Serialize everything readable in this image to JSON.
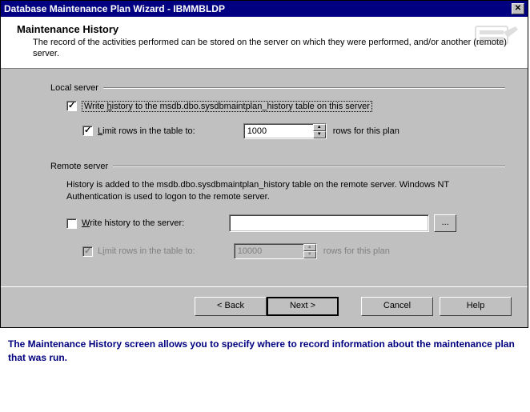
{
  "window": {
    "title": "Database Maintenance Plan Wizard - IBMMBLDP"
  },
  "header": {
    "title": "Maintenance History",
    "description": "The record of the activities performed can be stored on the server on which they were performed, and/or another (remote) server."
  },
  "local": {
    "group_label": "Local server",
    "write_history_label_pre": "Write ",
    "write_history_mnemonic": "h",
    "write_history_label_post": "istory to the msdb.dbo.sysdbmaintplan_history table on this server",
    "write_history_checked": true,
    "limit_rows_pre": "",
    "limit_rows_mnemonic": "L",
    "limit_rows_post": "imit rows in the table to:",
    "limit_rows_checked": true,
    "limit_rows_value": "1000",
    "rows_suffix": "rows for this plan"
  },
  "remote": {
    "group_label": "Remote server",
    "info_text": "History is added to the msdb.dbo.sysdbmaintplan_history table on the remote server. Windows NT Authentication is used to logon to the remote server.",
    "write_history_mnemonic": "W",
    "write_history_post": "rite history to the server:",
    "write_history_checked": false,
    "server_value": "",
    "browse_label": "...",
    "limit_rows_pre": "L",
    "limit_rows_mnemonic": "i",
    "limit_rows_post": "mit rows in the table to:",
    "limit_rows_checked": true,
    "limit_rows_value": "10000",
    "rows_suffix": "rows for this plan"
  },
  "buttons": {
    "back": "< Back",
    "next": "Next >",
    "cancel": "Cancel",
    "help": "Help"
  },
  "caption": "The Maintenance History screen allows you to specify where to record information about the maintenance plan that was run."
}
